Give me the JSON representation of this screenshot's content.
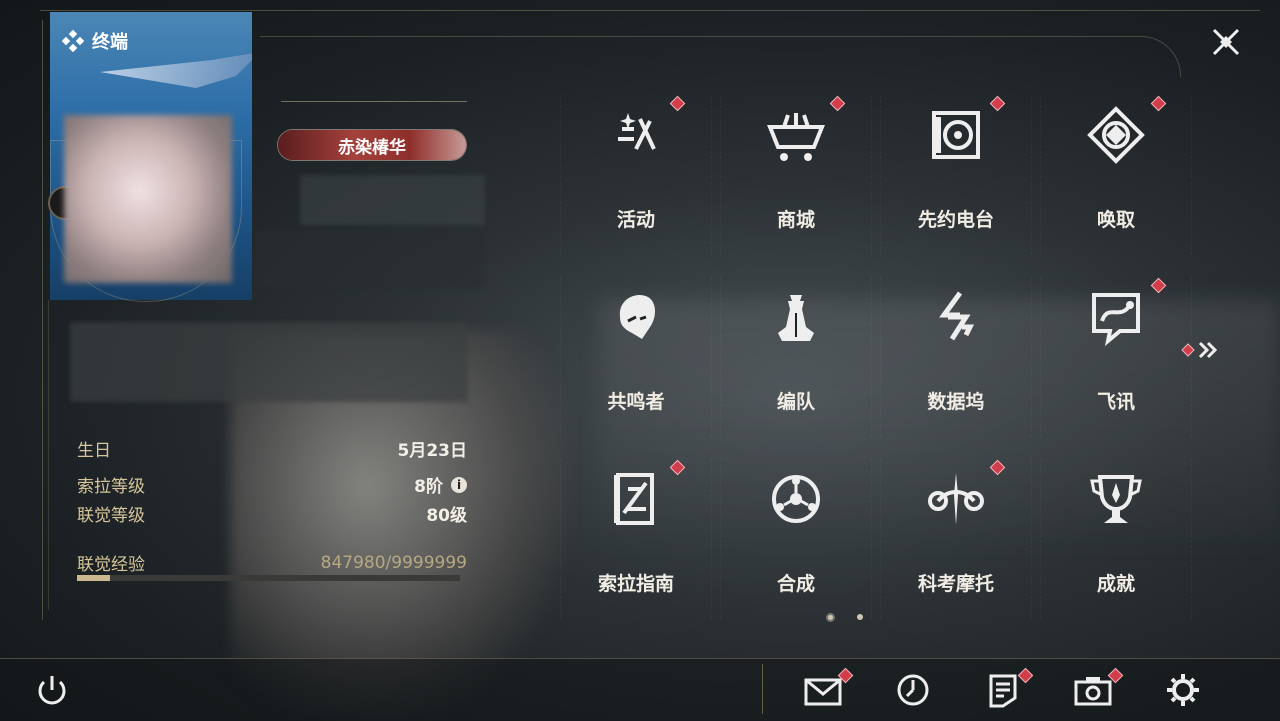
{
  "terminal": {
    "title": "终端"
  },
  "profile": {
    "title_badge": "赤染椿华",
    "birthday_label": "生日",
    "birthday_value": "5月23日",
    "sola_level_label": "索拉等级",
    "sola_level_value": "8阶",
    "union_level_label": "联觉等级",
    "union_level_value": "80级",
    "union_exp_label": "联觉经验",
    "union_exp_value": "847980/9999999",
    "union_exp_progress": 0.085
  },
  "menu": [
    {
      "label": "活动",
      "icon": "activity-icon",
      "badge": true
    },
    {
      "label": "商城",
      "icon": "shop-icon",
      "badge": true
    },
    {
      "label": "先约电台",
      "icon": "radio-icon",
      "badge": true
    },
    {
      "label": "唤取",
      "icon": "convene-icon",
      "badge": true
    },
    {
      "label": "共鸣者",
      "icon": "resonator-icon",
      "badge": false
    },
    {
      "label": "编队",
      "icon": "team-icon",
      "badge": false
    },
    {
      "label": "数据坞",
      "icon": "databank-icon",
      "badge": false
    },
    {
      "label": "飞讯",
      "icon": "message-icon",
      "badge": true
    },
    {
      "label": "索拉指南",
      "icon": "guidebook-icon",
      "badge": true
    },
    {
      "label": "合成",
      "icon": "synthesis-icon",
      "badge": false
    },
    {
      "label": "科考摩托",
      "icon": "motorcycle-icon",
      "badge": true
    },
    {
      "label": "成就",
      "icon": "trophy-icon",
      "badge": false
    }
  ],
  "pager": {
    "pages": 2,
    "current": 1
  },
  "colors": {
    "accent": "#d7c69a",
    "badge": "#d13d4b",
    "text": "#f1ede4"
  },
  "bottom_icons": [
    "power-icon",
    "mail-icon",
    "clock-icon",
    "notes-icon",
    "camera-icon",
    "settings-icon"
  ]
}
